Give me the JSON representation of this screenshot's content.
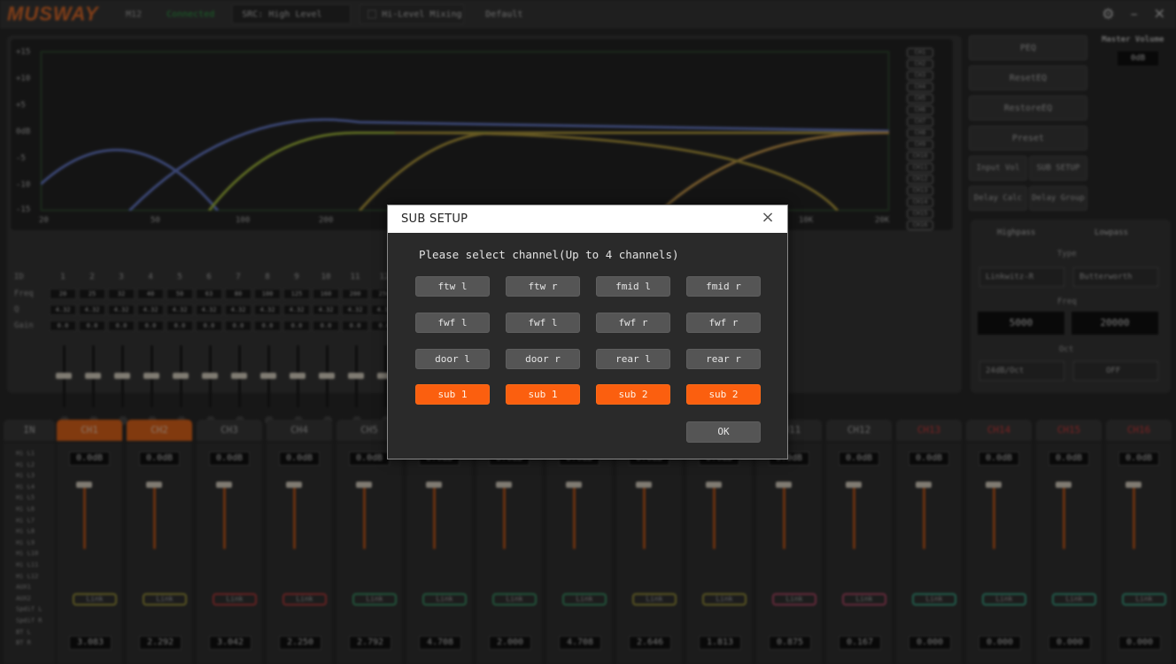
{
  "titlebar": {
    "logo": "MUSWAY",
    "device": "M12",
    "status": "Connected",
    "src_select": "SRC: High Level",
    "mixing_label": "Hi-Level Mixing",
    "preset": "Default"
  },
  "eq": {
    "y_labels": [
      "+15",
      "+10",
      "+5",
      "0dB",
      "-5",
      "-10",
      "-15"
    ],
    "x_labels": [
      "20",
      "50",
      "100",
      "200",
      "10K",
      "20K"
    ],
    "channel_legend": [
      "CH1",
      "CH2",
      "CH3",
      "CH4",
      "CH5",
      "CH6",
      "CH7",
      "CH8",
      "CH9",
      "CH10",
      "CH11",
      "CH12",
      "CH13",
      "CH14",
      "CH15",
      "CH16"
    ],
    "row_labels": {
      "id": "ID",
      "freq": "Freq",
      "q": "Q",
      "gain": "Gain",
      "bypass": "Bypass"
    },
    "band_numbers": [
      "1",
      "2",
      "3",
      "4",
      "5",
      "6",
      "7",
      "8",
      "9",
      "10",
      "11",
      "12"
    ],
    "freq_values": [
      "20",
      "25",
      "32",
      "40",
      "50",
      "63",
      "80",
      "100",
      "125",
      "160",
      "200",
      "250"
    ],
    "q_value": "4.32",
    "gain_value": "0.0",
    "slider_scale": [
      "15",
      "0",
      "-15"
    ]
  },
  "side": {
    "peq": "PEQ",
    "reset_eq": "ResetEQ",
    "restore_eq": "RestoreEQ",
    "preset": "Preset",
    "input_vol": "Input Vol",
    "sub_setup": "SUB SETUP",
    "delay_calc": "Delay Calc",
    "delay_group": "Delay Group"
  },
  "master": {
    "title": "Master Volume",
    "value": "0dB"
  },
  "filters": {
    "highpass": "Highpass",
    "lowpass": "Lowpass",
    "type_label": "Type",
    "hp_type": "Linkwitz-R",
    "lp_type": "Butterworth",
    "freq_label": "Freq",
    "hp_freq": "5000",
    "lp_freq": "20000",
    "oct_label": "Oct",
    "hp_oct": "24dB/Oct",
    "lp_oct": "OFF"
  },
  "channels": {
    "in_label": "IN",
    "tabs": [
      "CH1",
      "CH2",
      "CH3",
      "CH4",
      "CH5",
      "",
      "",
      "",
      "",
      "",
      "CH11",
      "CH12",
      "CH13",
      "CH14",
      "CH15",
      "CH16"
    ],
    "volume": "0.0dB",
    "link": "Link",
    "delays": [
      "3.083",
      "2.292",
      "3.042",
      "2.250",
      "2.792",
      "4.708",
      "2.000",
      "4.708",
      "2.646",
      "1.813",
      "0.875",
      "0.167",
      "0.000",
      "0.000",
      "0.000",
      "0.000"
    ],
    "inputs": [
      "Hi L1",
      "Hi L2",
      "Hi L3",
      "Hi L4",
      "Hi L5",
      "Hi L6",
      "Hi L7",
      "Hi L8",
      "Hi L9",
      "Hi L10",
      "Hi L11",
      "Hi L12",
      "AUX1",
      "AUX2",
      "Spdif L",
      "Spdif R",
      "BT L",
      "BT R"
    ]
  },
  "dialog": {
    "title": "SUB SETUP",
    "close_label": "×",
    "message": "Please select channel(Up to 4 channels)",
    "buttons": [
      [
        "ftw l",
        "ftw r",
        "fmid l",
        "fmid r"
      ],
      [
        "fwf l",
        "fwf l",
        "fwf r",
        "fwf r"
      ],
      [
        "door l",
        "door r",
        "rear l",
        "rear r"
      ],
      [
        "sub 1",
        "sub 1",
        "sub 2",
        "sub 2"
      ]
    ],
    "selected_row": 3,
    "ok_label": "OK"
  },
  "colors": {
    "accent": "#fb5f0f",
    "button": "#555555",
    "dialog_bg": "#2a2a2a",
    "header_bg": "#ffffff"
  }
}
